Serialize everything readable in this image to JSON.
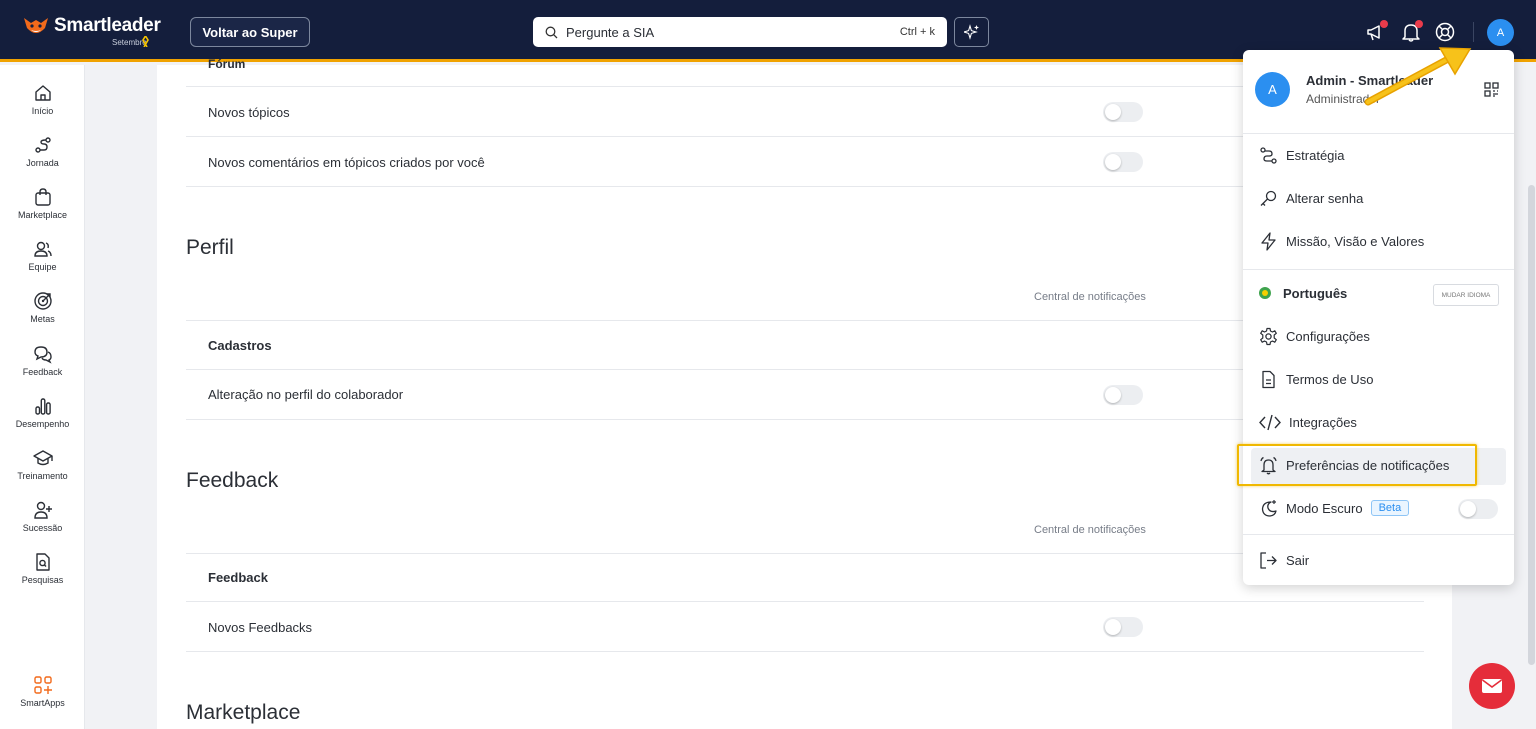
{
  "topbar": {
    "logo_name": "Smartleader",
    "logo_month": "Setembro",
    "super_button": "Voltar ao Super",
    "search_placeholder": "Pergunte a SIA",
    "search_shortcut": "Ctrl + k",
    "icons": [
      "megaphone-icon",
      "bell-icon",
      "help-lifebuoy-icon"
    ],
    "avatar_initial": "A"
  },
  "sidebar": {
    "items": [
      {
        "label": "Início",
        "icon": "home-icon"
      },
      {
        "label": "Jornada",
        "icon": "route-icon"
      },
      {
        "label": "Marketplace",
        "icon": "shopping-bag-icon"
      },
      {
        "label": "Equipe",
        "icon": "users-icon"
      },
      {
        "label": "Metas",
        "icon": "target-icon"
      },
      {
        "label": "Feedback",
        "icon": "messages-icon"
      },
      {
        "label": "Desempenho",
        "icon": "bar-chart-icon"
      },
      {
        "label": "Treinamento",
        "icon": "graduation-cap-icon"
      },
      {
        "label": "Sucessão",
        "icon": "user-plus-icon"
      },
      {
        "label": "Pesquisas",
        "icon": "file-search-icon"
      }
    ],
    "apps_label": "SmartApps"
  },
  "main": {
    "forum": {
      "partial_title": "Fórum",
      "rows": [
        {
          "label": "Novos tópicos",
          "enabled": false
        },
        {
          "label": "Novos comentários em tópicos criados por você",
          "enabled": false
        }
      ]
    },
    "perfil": {
      "title": "Perfil",
      "column_header": "Central de notificações",
      "group": "Cadastros",
      "rows": [
        {
          "label": "Alteração no perfil do colaborador",
          "enabled": false
        }
      ]
    },
    "feedback": {
      "title": "Feedback",
      "column_header": "Central de notificações",
      "group": "Feedback",
      "rows": [
        {
          "label": "Novos Feedbacks",
          "enabled": false
        }
      ]
    },
    "marketplace": {
      "title": "Marketplace"
    }
  },
  "menu": {
    "user_initial": "A",
    "user_name": "Admin - Smartleader",
    "user_role": "Administrador",
    "items": {
      "estrategia": "Estratégia",
      "alterar_senha": "Alterar senha",
      "missao": "Missão, Visão e Valores",
      "idioma": "Português",
      "mudar_idioma": "MUDAR IDIOMA",
      "configuracoes": "Configurações",
      "termos": "Termos de Uso",
      "integracoes": "Integrações",
      "preferencias": "Preferências de notificações",
      "modo_escuro": "Modo Escuro",
      "beta": "Beta",
      "sair": "Sair"
    },
    "dark_mode_enabled": false
  },
  "colors": {
    "topbar": "#141e3c",
    "accent": "#f0a200",
    "avatar": "#2b8ff0",
    "chat": "#e52d3a"
  }
}
